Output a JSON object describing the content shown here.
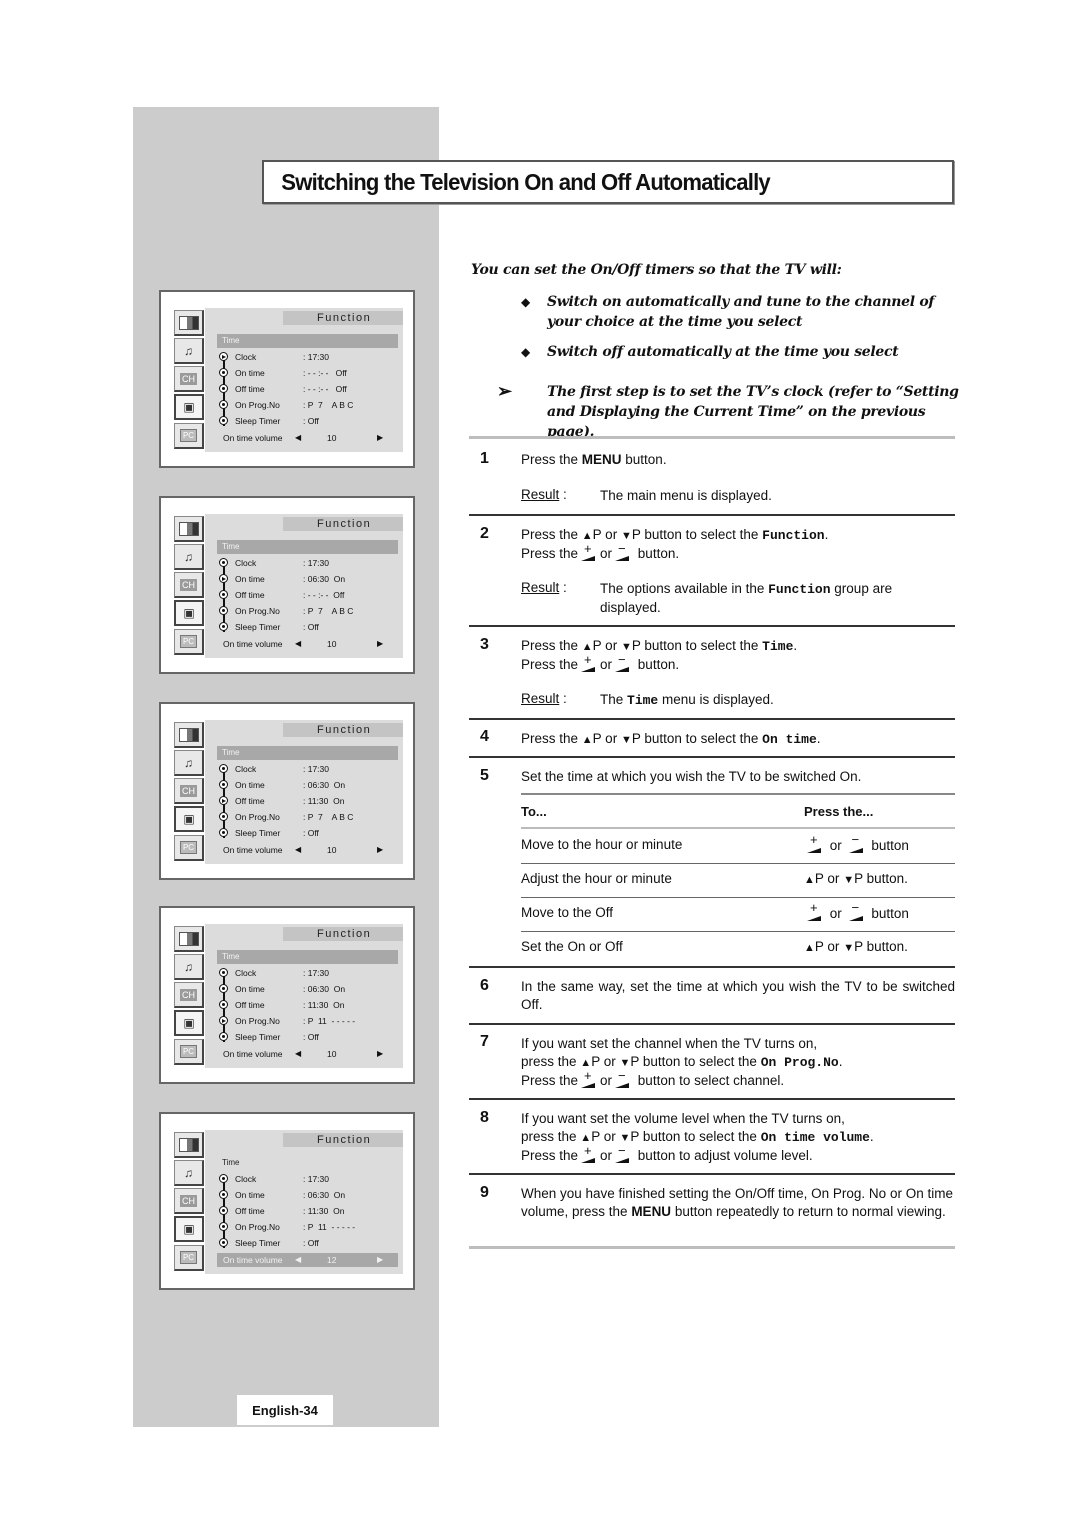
{
  "title": "Switching the Television On and Off Automatically",
  "intro": "You can set the On/Off timers so that the TV will:",
  "bullets": [
    "Switch on automatically and tune to the channel of your choice at the time you select",
    "Switch off automatically at the time you select"
  ],
  "note": "The first step is to set the TV’s clock (refer to “Setting and Displaying the Current Time” on the previous page).",
  "icons": {
    "bullet": "◆",
    "note_arrow": "➢",
    "up_triangle": "▲",
    "down_triangle": "▼",
    "left_arrow": "◀",
    "right_arrow": "▶"
  },
  "common": {
    "result": "Result",
    "or": "or",
    "press_the": "Press the",
    "press_the_lc": "press the"
  },
  "steps": [
    {
      "num": "1",
      "text_a": "Press the ",
      "key": "MENU",
      "text_b": " button.",
      "result": "The main menu is displayed."
    },
    {
      "num": "2",
      "line1_a": "Press the ",
      "line1_b": "P or ",
      "line1_c": "P button to select the ",
      "line1_code": "Function",
      "line2_b": " button.",
      "result_a": "The options available in the ",
      "result_code": "Function",
      "result_b": " group are displayed."
    },
    {
      "num": "3",
      "line1_a": "Press the ",
      "line1_b": "P or ",
      "line1_c": "P button to select the ",
      "line1_code": "Time",
      "line2_b": " button.",
      "result_a": "The ",
      "result_code": "Time",
      "result_b": " menu is displayed."
    },
    {
      "num": "4",
      "line1_a": "Press the ",
      "line1_b": "P or ",
      "line1_c": "P button to select the ",
      "line1_code": "On time"
    },
    {
      "num": "5",
      "text": "Set the time at which you wish the TV to be switched On."
    },
    {
      "num": "6",
      "text": "In the same way, set the time at which you wish the TV to be switched Off."
    },
    {
      "num": "7",
      "line0": "If you want set the channel when the TV turns on,",
      "line1_c": "P button to select the ",
      "line1_code": "On Prog.No",
      "line2_b": " button to select channel."
    },
    {
      "num": "8",
      "line0": "If you want set the volume level when the TV turns on,",
      "line1_c": "P button to select the ",
      "line1_code": "On time volume",
      "line2_b": " button to adjust volume level."
    },
    {
      "num": "9",
      "text_a": "When you have finished setting the On/Off time, On Prog. No or On time volume, press the ",
      "key": "MENU",
      "text_b": " button repeatedly to return to normal viewing."
    }
  ],
  "table": {
    "headers": [
      "To...",
      "Press the..."
    ],
    "rows": [
      {
        "action": "Move to the hour or minute",
        "press": "button",
        "type": "plusminus"
      },
      {
        "action": "Adjust the hour or minute",
        "press": "button.",
        "type": "updown"
      },
      {
        "action": "Move to the Off",
        "press": "button",
        "type": "plusminus"
      },
      {
        "action": "Set the On or Off",
        "press": "button.",
        "type": "updown"
      }
    ]
  },
  "osd_common": {
    "header": "Function",
    "group": "Time",
    "labels": [
      "Clock",
      "On time",
      "Off time",
      "On Prog.No",
      "Sleep Timer"
    ],
    "volume_label": "On time volume",
    "side_icons": [
      "picture-icon",
      "sound-icon",
      "channel-icon",
      "function-icon",
      "pc-icon"
    ],
    "ch_text": "CH",
    "pc_text": "PC"
  },
  "osd_panels": [
    {
      "values": [
        ": 17:30",
        ": - - :- -   Off",
        ": - - :- -   Off",
        ": P  7    A B C",
        ": Off"
      ],
      "volume": "10",
      "active_row": 0,
      "group_highlight": true,
      "volume_highlight": false
    },
    {
      "values": [
        ": 17:30",
        ": 06:30  On",
        ": - - :- -  Off",
        ": P  7    A B C",
        ": Off"
      ],
      "volume": "10",
      "active_row": 1,
      "group_highlight": true,
      "volume_highlight": false
    },
    {
      "values": [
        ": 17:30",
        ": 06:30  On",
        ": 11:30  On",
        ": P  7    A B C",
        ": Off"
      ],
      "volume": "10",
      "active_row": 2,
      "group_highlight": true,
      "volume_highlight": false
    },
    {
      "values": [
        ": 17:30",
        ": 06:30  On",
        ": 11:30  On",
        ": P  11  - - - - -",
        ": Off"
      ],
      "volume": "10",
      "active_row": 3,
      "group_highlight": true,
      "volume_highlight": false
    },
    {
      "values": [
        ": 17:30",
        ": 06:30  On",
        ": 11:30  On",
        ": P  11  - - - - -",
        ": Off"
      ],
      "volume": "12",
      "active_row": -1,
      "group_highlight": false,
      "volume_highlight": true
    }
  ],
  "footer": {
    "page_label": "English-34"
  }
}
